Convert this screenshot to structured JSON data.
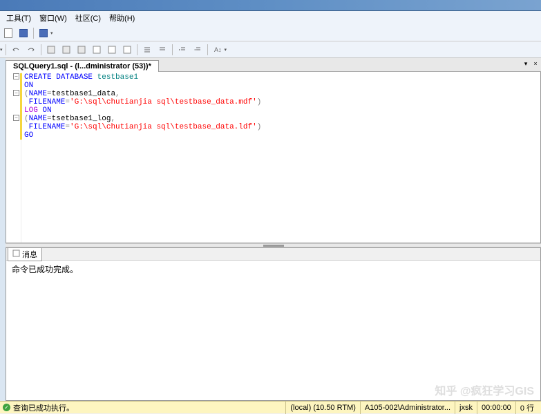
{
  "menubar": {
    "tools": "工具(T)",
    "window": "窗口(W)",
    "community": "社区(C)",
    "help": "帮助(H)"
  },
  "tab": {
    "title": "SQLQuery1.sql - (l...dministrator (53))*"
  },
  "tab_controls": {
    "dropdown": "▾",
    "close": "×"
  },
  "fold": {
    "minus": "−",
    "plus": "+"
  },
  "code": {
    "l1_kw1": "CREATE",
    "l1_kw2": " DATABASE",
    "l1_name": " testbase1",
    "l2_on": "ON",
    "l3_p": "(",
    "l3_kw": "NAME",
    "l3_eq": "=",
    "l3_val": "testbase1_data",
    "l3_c": ",",
    "l4_kw": " FILENAME",
    "l4_eq": "=",
    "l4_str": "'G:\\sql\\chutianjia sql\\testbase_data.mdf'",
    "l4_p": ")",
    "l5_log": "LOG",
    "l5_on": " ON",
    "l6_p": "(",
    "l6_kw": "NAME",
    "l6_eq": "=",
    "l6_val": "tsetbase1_log",
    "l6_c": ",",
    "l7_kw": " FILENAME",
    "l7_eq": "=",
    "l7_str": "'G:\\sql\\chutianjia sql\\testbase_data.ldf'",
    "l7_p": ")",
    "l8_go": "GO"
  },
  "results": {
    "tab_label": "消息",
    "message": "命令已成功完成。"
  },
  "status": {
    "exec": "查询已成功执行。",
    "server": "(local) (10.50 RTM)",
    "user": "A105-002\\Administrator...",
    "db": "jxsk",
    "time": "00:00:00",
    "rows": "0 行"
  },
  "watermark": "知乎 @疯狂学习GIS"
}
